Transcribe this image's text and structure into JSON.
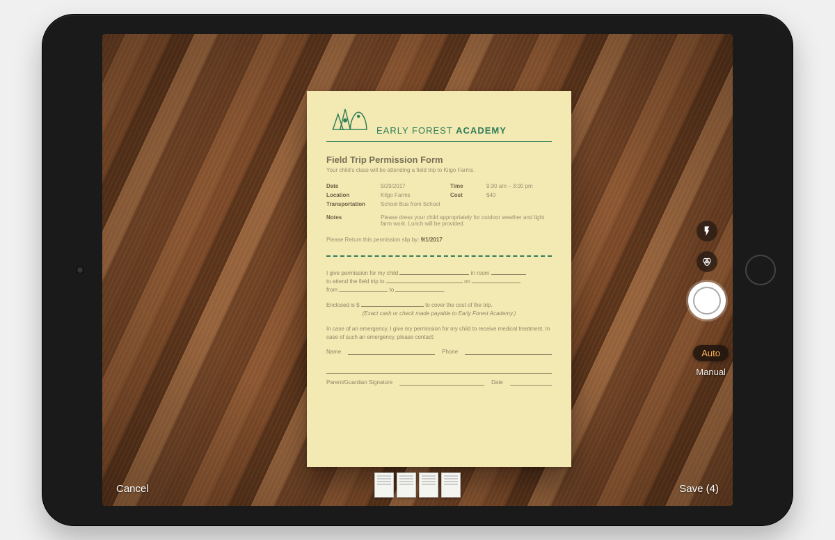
{
  "ui": {
    "cancel": "Cancel",
    "save": "Save (4)",
    "mode_auto": "Auto",
    "mode_manual": "Manual",
    "flash_icon": "flash-icon",
    "filter_icon": "filter-icon",
    "thumb_count": 4
  },
  "document": {
    "brand_pre": "EARLY FOREST ",
    "brand_bold": "ACADEMY",
    "title": "Field Trip Permission Form",
    "subtitle": "Your child's class will be attending a field trip to Kilgo Farms.",
    "fields": {
      "date_label": "Date",
      "date_value": "9/29/2017",
      "time_label": "Time",
      "time_value": "9:30 am – 3:00 pm",
      "location_label": "Location",
      "location_value": "Kilgo Farms",
      "cost_label": "Cost",
      "cost_value": "$40",
      "transport_label": "Transportation",
      "transport_value": "School Bus from School",
      "notes_label": "Notes",
      "notes_value": "Please dress your child appropriately for outdoor weather and light farm work. Lunch will be provided."
    },
    "return_prefix": "Please Return this permission slip by: ",
    "return_date": "9/1/2017",
    "perm": {
      "l1a": "I give permission for my child",
      "l1b": "in room",
      "l2a": "to attend the field trip to",
      "l2b": "on",
      "l3a": "from",
      "l3b": "to",
      "enc_a": "Enclosed is  $",
      "enc_b": "to cover the cost of the trip.",
      "enc_note": "(Exact cash or check made payable to Early Forest Academy.)",
      "emerg": "In case of an emergency, I give my permission for my child to receive medical treatment. In case of such an emergency, please contact:",
      "name": "Name",
      "phone": "Phone",
      "sig": "Parent/Guardian Signature",
      "sig_date": "Date"
    }
  }
}
